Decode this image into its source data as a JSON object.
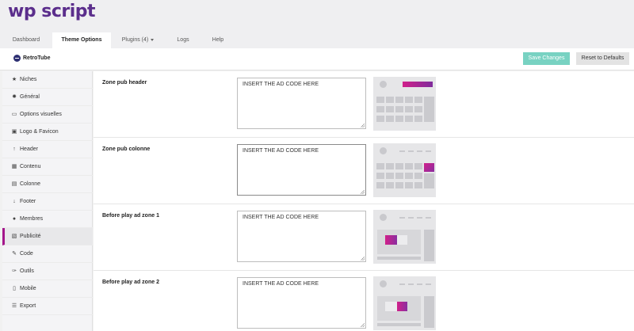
{
  "app": {
    "logo": "wp script"
  },
  "tabs": [
    {
      "label": "Dashboard"
    },
    {
      "label": "Theme Options"
    },
    {
      "label": "Plugins (4)"
    },
    {
      "label": "Logs"
    },
    {
      "label": "Help"
    }
  ],
  "header": {
    "brand": "RetroTube",
    "save_label": "Save Changes",
    "reset_label": "Reset to Defaults"
  },
  "sidebar": {
    "items": [
      {
        "label": "Niches",
        "icon": "star-icon"
      },
      {
        "label": "Général",
        "icon": "gear-icon"
      },
      {
        "label": "Options visuelles",
        "icon": "monitor-icon"
      },
      {
        "label": "Logo & Favicon",
        "icon": "image-icon"
      },
      {
        "label": "Header",
        "icon": "arrow-up-icon"
      },
      {
        "label": "Contenu",
        "icon": "grid-icon"
      },
      {
        "label": "Colonne",
        "icon": "columns-icon"
      },
      {
        "label": "Footer",
        "icon": "arrow-down-icon"
      },
      {
        "label": "Membres",
        "icon": "user-icon"
      },
      {
        "label": "Publicité",
        "icon": "ad-icon"
      },
      {
        "label": "Code",
        "icon": "pencil-icon"
      },
      {
        "label": "Outils",
        "icon": "wrench-icon"
      },
      {
        "label": "Mobile",
        "icon": "mobile-icon"
      },
      {
        "label": "Export",
        "icon": "database-icon"
      }
    ],
    "active": "Publicité"
  },
  "zones": [
    {
      "label": "Zone pub header",
      "value": "INSERT THE AD CODE HERE"
    },
    {
      "label": "Zone pub colonne",
      "value": "INSERT THE AD CODE HERE"
    },
    {
      "label": "Before play ad zone 1",
      "value": "INSERT THE AD CODE HERE"
    },
    {
      "label": "Before play ad zone 2",
      "value": "INSERT THE AD CODE HERE"
    }
  ],
  "colors": {
    "brand": "#5b2e8c",
    "accent": "#a4168b",
    "save_button": "#78d2c2",
    "ad_gradient_start": "#d1208a",
    "ad_gradient_end": "#7f2c9c"
  }
}
